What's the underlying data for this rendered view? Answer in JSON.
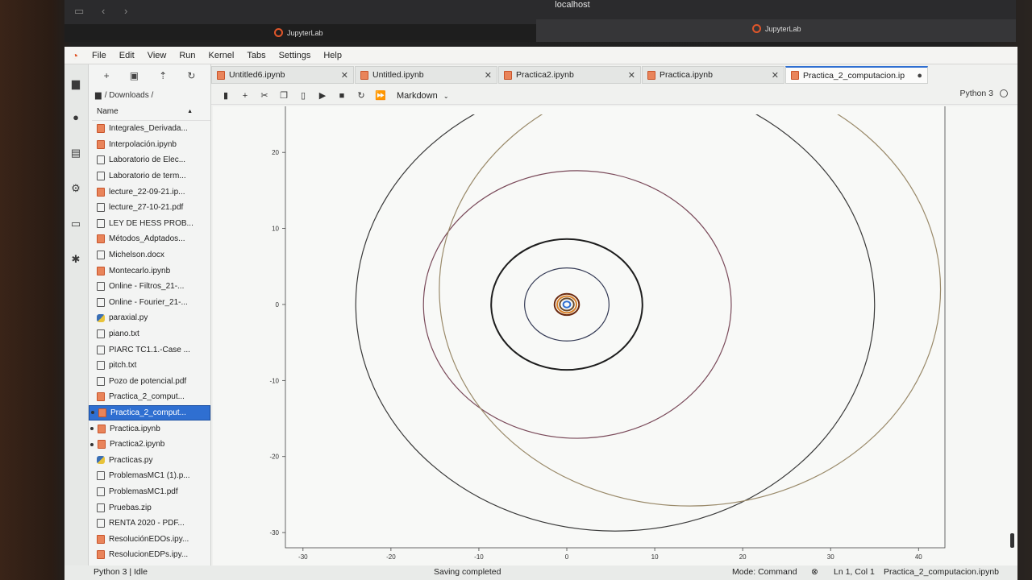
{
  "browser": {
    "url": "localhost",
    "tab_left": "JupyterLab",
    "tab_right": "JupyterLab"
  },
  "menu": [
    "File",
    "Edit",
    "View",
    "Run",
    "Kernel",
    "Tabs",
    "Settings",
    "Help"
  ],
  "file_browser": {
    "breadcrumb": "/ Downloads /",
    "column_name": "Name",
    "items": [
      {
        "name": "Integrales_Derivada...",
        "type": "nb",
        "running": false,
        "selected": false
      },
      {
        "name": "Interpolación.ipynb",
        "type": "nb",
        "running": false,
        "selected": false
      },
      {
        "name": "Laboratorio de Elec...",
        "type": "file",
        "running": false,
        "selected": false
      },
      {
        "name": "Laboratorio de term...",
        "type": "file",
        "running": false,
        "selected": false
      },
      {
        "name": "lecture_22-09-21.ip...",
        "type": "nb",
        "running": false,
        "selected": false
      },
      {
        "name": "lecture_27-10-21.pdf",
        "type": "file",
        "running": false,
        "selected": false
      },
      {
        "name": "LEY DE HESS PROB...",
        "type": "file",
        "running": false,
        "selected": false
      },
      {
        "name": "Métodos_Adptados...",
        "type": "nb",
        "running": false,
        "selected": false
      },
      {
        "name": "Michelson.docx",
        "type": "file",
        "running": false,
        "selected": false
      },
      {
        "name": "Montecarlo.ipynb",
        "type": "nb",
        "running": false,
        "selected": false
      },
      {
        "name": "Online - Filtros_21-...",
        "type": "file",
        "running": false,
        "selected": false
      },
      {
        "name": "Online - Fourier_21-...",
        "type": "file",
        "running": false,
        "selected": false
      },
      {
        "name": "paraxial.py",
        "type": "py",
        "running": false,
        "selected": false
      },
      {
        "name": "piano.txt",
        "type": "file",
        "running": false,
        "selected": false
      },
      {
        "name": "PIARC TC1.1.-Case ...",
        "type": "file",
        "running": false,
        "selected": false
      },
      {
        "name": "pitch.txt",
        "type": "file",
        "running": false,
        "selected": false
      },
      {
        "name": "Pozo de potencial.pdf",
        "type": "file",
        "running": false,
        "selected": false
      },
      {
        "name": "Practica_2_comput...",
        "type": "nb",
        "running": false,
        "selected": false
      },
      {
        "name": "Practica_2_comput...",
        "type": "nb",
        "running": true,
        "selected": true
      },
      {
        "name": "Practica.ipynb",
        "type": "nb",
        "running": true,
        "selected": false
      },
      {
        "name": "Practica2.ipynb",
        "type": "nb",
        "running": true,
        "selected": false
      },
      {
        "name": "Practicas.py",
        "type": "py",
        "running": false,
        "selected": false
      },
      {
        "name": "ProblemasMC1 (1).p...",
        "type": "file",
        "running": false,
        "selected": false
      },
      {
        "name": "ProblemasMC1.pdf",
        "type": "file",
        "running": false,
        "selected": false
      },
      {
        "name": "Pruebas.zip",
        "type": "file",
        "running": false,
        "selected": false
      },
      {
        "name": "RENTA 2020 - PDF...",
        "type": "file",
        "running": false,
        "selected": false
      },
      {
        "name": "ResoluciónEDOs.ipy...",
        "type": "nb",
        "running": false,
        "selected": false
      },
      {
        "name": "ResolucionEDPs.ipy...",
        "type": "nb",
        "running": false,
        "selected": false
      }
    ]
  },
  "doc_tabs": [
    {
      "label": "Untitled6.ipynb",
      "active": false,
      "dirty": false
    },
    {
      "label": "Untitled.ipynb",
      "active": false,
      "dirty": false
    },
    {
      "label": "Practica2.ipynb",
      "active": false,
      "dirty": false
    },
    {
      "label": "Practica.ipynb",
      "active": false,
      "dirty": false
    },
    {
      "label": "Practica_2_computacion.ip",
      "active": true,
      "dirty": true
    }
  ],
  "notebook_toolbar": {
    "cell_type": "Markdown",
    "kernel": "Python 3"
  },
  "chart_data": {
    "type": "scatter",
    "xlim": [
      -32,
      43
    ],
    "ylim": [
      -32,
      25
    ],
    "x_ticks": [
      -30,
      -20,
      -10,
      0,
      10,
      20,
      30,
      40
    ],
    "y_ticks": [
      20,
      10,
      0,
      -10,
      -20,
      -30
    ],
    "grid": false,
    "series": [
      {
        "cx": 0,
        "cy": 0,
        "rx": 0.4,
        "ry": 0.4,
        "color": "#2f6fd1"
      },
      {
        "cx": 0,
        "cy": 0,
        "rx": 0.8,
        "ry": 0.8,
        "color": "#6b4a2a"
      },
      {
        "cx": 0,
        "cy": 0,
        "rx": 1.1,
        "ry": 1.1,
        "color": "#d9822b"
      },
      {
        "cx": 0,
        "cy": 0,
        "rx": 1.4,
        "ry": 1.4,
        "color": "#6b2a10"
      },
      {
        "cx": 0,
        "cy": 0,
        "rx": 4.8,
        "ry": 4.8,
        "color": "#343a55"
      },
      {
        "cx": 0,
        "cy": 0,
        "rx": 8.6,
        "ry": 8.6,
        "color": "#1e1e1e"
      },
      {
        "cx": 1.2,
        "cy": 0,
        "rx": 17.5,
        "ry": 17.6,
        "color": "#7a4a5a"
      },
      {
        "cx": 5.5,
        "cy": 0,
        "rx": 29.5,
        "ry": 29.8,
        "color": "#3a3a3a"
      },
      {
        "cx": 14,
        "cy": 2,
        "rx": 28.5,
        "ry": 28.5,
        "color": "#9a8a6a"
      }
    ]
  },
  "status": {
    "left": "Python 3 | Idle",
    "center": "Saving completed",
    "mode": "Mode: Command",
    "position": "Ln 1, Col 1",
    "filename": "Practica_2_computacion.ipynb"
  }
}
